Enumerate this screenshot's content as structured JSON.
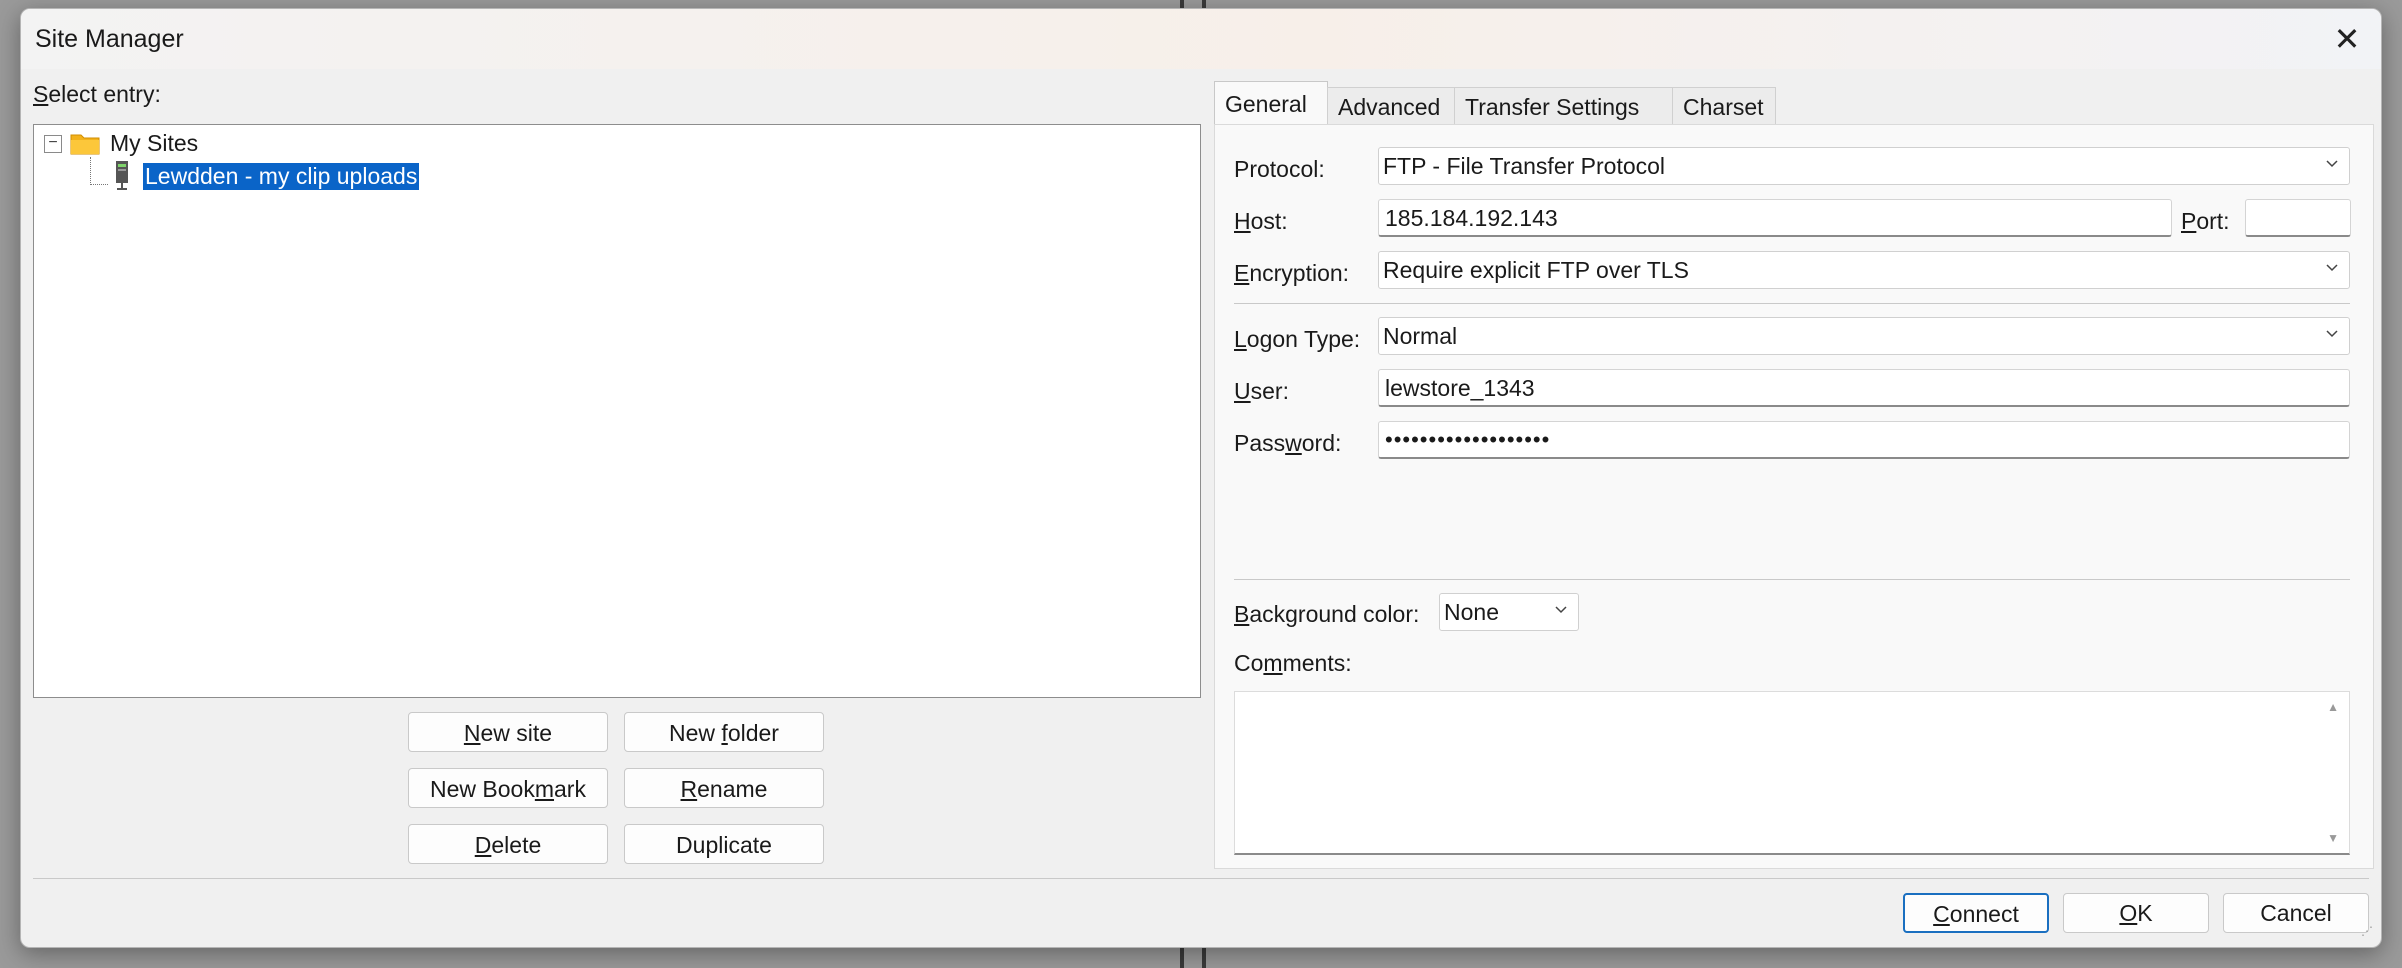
{
  "window": {
    "title": "Site Manager"
  },
  "select_entry": {
    "prefix": "",
    "mnemonic": "S",
    "rest": "elect entry:"
  },
  "tree": {
    "root": {
      "label": "My Sites",
      "expanded": true,
      "toggle": "−"
    },
    "items": [
      {
        "label": "Lewdden - my clip uploads",
        "selected": true
      }
    ]
  },
  "tree_buttons": [
    {
      "pre": "",
      "mn": "N",
      "post": "ew site"
    },
    {
      "pre": "New ",
      "mn": "f",
      "post": "older"
    },
    {
      "pre": "New Book",
      "mn": "m",
      "post": "ark"
    },
    {
      "pre": "",
      "mn": "R",
      "post": "ename"
    },
    {
      "pre": "",
      "mn": "D",
      "post": "elete"
    },
    {
      "pre": "Duplicate",
      "mn": "",
      "post": ""
    }
  ],
  "tabs": [
    "General",
    "Advanced",
    "Transfer Settings",
    "Charset"
  ],
  "active_tab": "General",
  "general": {
    "protocol": {
      "pre": "",
      "mn": "",
      "post": "Protocol:",
      "value": "FTP - File Transfer Protocol"
    },
    "host": {
      "pre": "",
      "mn": "H",
      "post": "ost:",
      "value": "185.184.192.143"
    },
    "port": {
      "pre": "",
      "mn": "P",
      "post": "ort:",
      "value": ""
    },
    "encryption": {
      "pre": "",
      "mn": "E",
      "post": "ncryption:",
      "value": "Require explicit FTP over TLS"
    },
    "logon_type": {
      "pre": "",
      "mn": "L",
      "post": "ogon Type:",
      "value": "Normal"
    },
    "user": {
      "pre": "",
      "mn": "U",
      "post": "ser:",
      "value": "lewstore_1343"
    },
    "password": {
      "pre": "Pass",
      "mn": "w",
      "post": "ord:",
      "value": "•••••••••••••••••••"
    },
    "background_color": {
      "pre": "",
      "mn": "B",
      "post": "ackground color:",
      "value": "None"
    },
    "comments": {
      "pre": "Co",
      "mn": "m",
      "post": "ments:",
      "value": ""
    }
  },
  "actions": [
    {
      "pre": "",
      "mn": "C",
      "post": "onnect",
      "default": true
    },
    {
      "pre": "",
      "mn": "O",
      "post": "K",
      "default": false
    },
    {
      "pre": "Cancel",
      "mn": "",
      "post": "",
      "default": false
    }
  ],
  "colors": {
    "selection": "#0a64c8",
    "default_button_border": "#1a6fc0",
    "folder": "#f3b21b"
  }
}
